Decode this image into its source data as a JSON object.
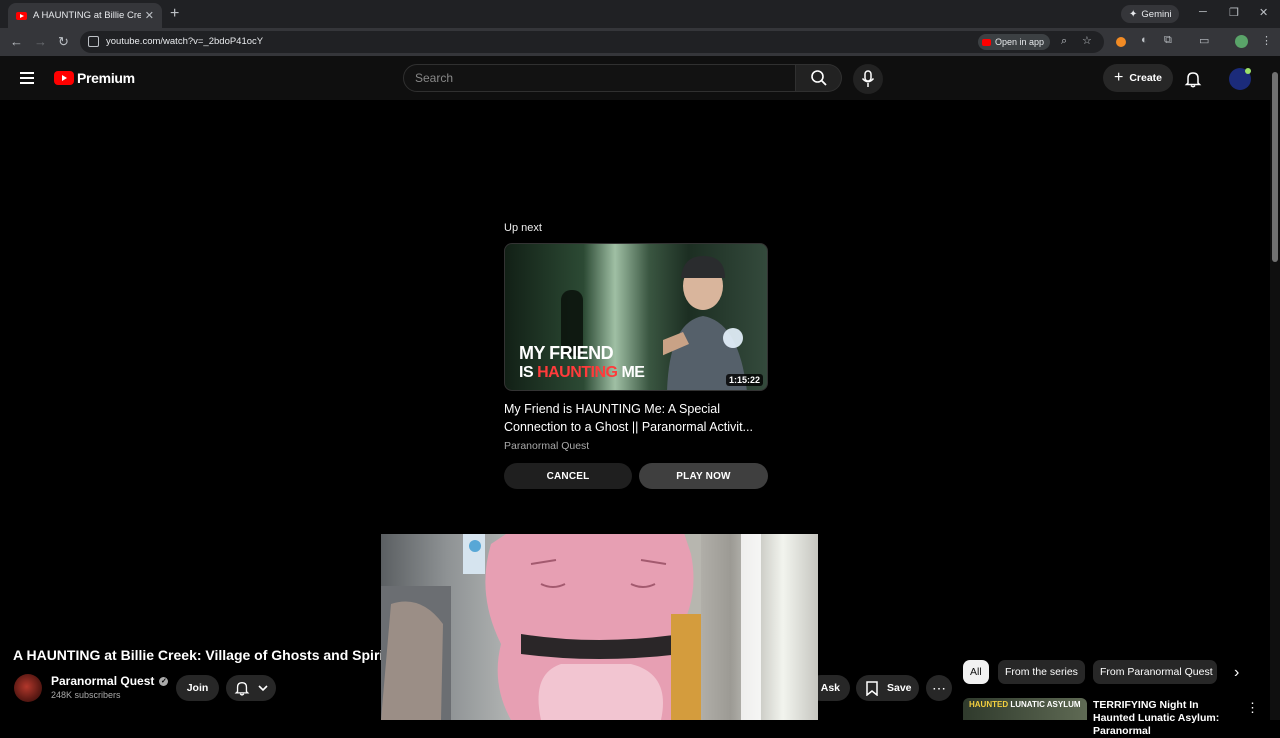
{
  "browser": {
    "tab_title": "A HAUNTING at Billie Creek Vi",
    "url": "youtube.com/watch?v=_2bdoP41ocY",
    "gemini_label": "Gemini",
    "open_in_app_label": "Open in app"
  },
  "header": {
    "logo_text": "Premium",
    "search_placeholder": "Search",
    "create_label": "Create"
  },
  "up_next": {
    "label": "Up next",
    "thumbnail_line1": "MY FRIEND",
    "thumbnail_line2_prefix": "IS ",
    "thumbnail_line2_red": "HAUNTING",
    "thumbnail_line2_suffix": " ME",
    "duration": "1:15:22",
    "title": "My Friend is HAUNTING Me: A Special Connection to a Ghost || Paranormal Activit...",
    "channel": "Paranormal Quest",
    "cancel_label": "CANCEL",
    "play_now_label": "PLAY NOW"
  },
  "video": {
    "title": "A HAUNTING at Billie Creek: Village of Ghosts and Spirit",
    "channel_name": "Paranormal Quest",
    "subscribers": "248K subscribers",
    "join_label": "Join",
    "ask_label": "Ask",
    "save_label": "Save"
  },
  "chips": {
    "all": "All",
    "from_series": "From the series",
    "from_channel": "From Paranormal Quest"
  },
  "recommendation": {
    "thumb_text_yellow": "HAUNTED",
    "thumb_text_white": " LUNATIC ASYLUM",
    "title": "TERRIFYING Night In Haunted Lunatic Asylum: Paranormal"
  },
  "colors": {
    "brand_red": "#ff0000",
    "background": "#0f0f0f",
    "thumb_red_text": "#ff3b3b"
  }
}
